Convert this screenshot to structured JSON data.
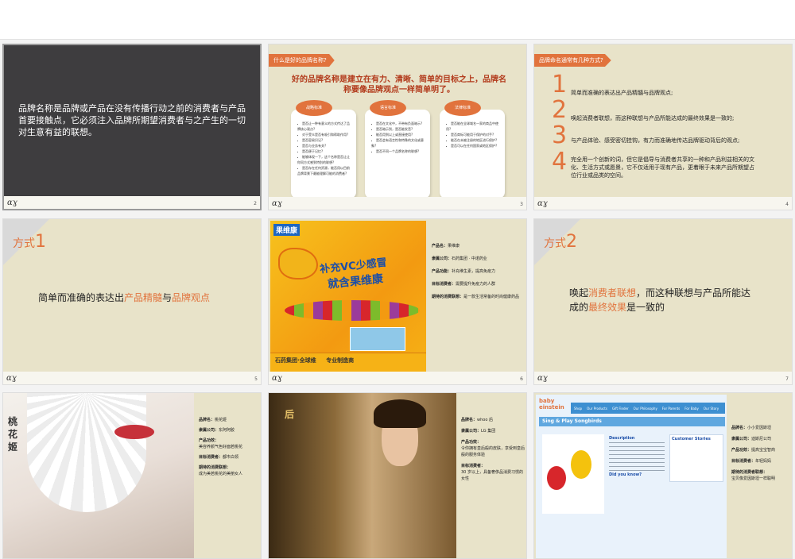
{
  "slides": [
    {
      "num": "2",
      "text": "品牌名称是品牌或产品在没有传播行动之前的消费者与产品首要接触点，它必须注入品牌所期望消费者与之产生的一切对生意有益的联想。"
    },
    {
      "num": "3",
      "tab": "什么是好的品牌名称?",
      "title": "好的品牌名称是建立在有力、清晰、简单的目标之上，品牌名称要像品牌观点一样简单明了。",
      "bubbles": [
        {
          "head": "战略标准",
          "items": [
            "是否让一种有意义的方式传达了品牌核心观点?",
            "对于受众是否有吸引和帮助作用?",
            "是否容易识记?",
            "是否与业务有关?",
            "是否便于记忆?",
            "能够体现一下，这个名称是否让让你同方式感到特别的联想?",
            "是否存在任何资源，能否用以目前品牌背景下最能理解可能的消费者?"
          ]
        },
        {
          "head": "语言标准",
          "items": [
            "是否在文化中，不带有负面暗示?",
            "是否暗示到，是否能发音?",
            "能否用到以上或直接使用?",
            "是否会有语言性和特殊的文化或意象?",
            "是否不同一个品牌名称的联想?"
          ]
        },
        {
          "head": "法律标准",
          "items": [
            "是否能在全球域名一家的商品中使用?",
            "是否商标可能用于保护的对手?",
            "能否在未被注册的地区进行保护?",
            "是否可以在任何国家或地区保护?"
          ]
        }
      ]
    },
    {
      "num": "4",
      "tab": "品牌命名通常有几种方式?",
      "items": [
        {
          "n": "1",
          "t": "简单而准确的表达出产品精髓与品牌观点;"
        },
        {
          "n": "2",
          "t": "唤起消费者联想，而这种联想与产品所能达成的最终效果是一致的;"
        },
        {
          "n": "3",
          "t": "与产品体验、感受密切挂钩，有力而准确地传达品牌驱动背后的观点;"
        },
        {
          "n": "4",
          "t": "完全用一个创新的词，但它是倡导与消费者共享的一种和产品利益相关的文化、生活方式或愿景，它不仅适用于现有产品，更着眼于未来产品所期望占位行业或品类的空间。"
        }
      ]
    },
    {
      "num": "5",
      "way_label": "方式",
      "way_num": "1",
      "s1": "简单而准确的表达出",
      "h1": "产品精髓",
      "s2": "与",
      "h2": "品牌观点"
    },
    {
      "num": "6",
      "brand_logo": "果维康",
      "slogan1": "补充VC少感冒",
      "slogan2": "就含果维康",
      "footer_brand": "石药集团·全球维",
      "footer2": "专业制造商",
      "fields": [
        {
          "k": "产品名：",
          "v": "果维康"
        },
        {
          "k": "隶属公司：",
          "v": "石药集团 · 中诺药业"
        },
        {
          "k": "产品功能：",
          "v": "补充维生素，提高免疫力"
        },
        {
          "k": "目标消费者：",
          "v": "需要提升免疫力的人群"
        },
        {
          "k": "期待的消费联想：",
          "v": "是一款生活常备的时尚健康药品"
        }
      ]
    },
    {
      "num": "7",
      "way_label": "方式",
      "way_num": "2",
      "s1": "唤起",
      "h1": "消费者联想",
      "s2": "，而这种联想与产品所能达成的",
      "h2": "最终效果",
      "s3": "是一致的"
    },
    {
      "num": "8",
      "side": "桃花姬",
      "fields": [
        {
          "k": "品牌名：",
          "v": "桃花姬"
        },
        {
          "k": "隶属公司：",
          "v": "东阿阿胶"
        },
        {
          "k": "产品功效：",
          "v": "美容养颜气色好面若桃花"
        },
        {
          "k": "目标消费者：",
          "v": "都市白领"
        },
        {
          "k": "期待的消费联想：",
          "v": "成为美若桃花的美丽女人"
        }
      ]
    },
    {
      "num": "9",
      "fields": [
        {
          "k": "品牌名：",
          "v": "whoo 后"
        },
        {
          "k": "隶属公司：",
          "v": "LG 集团"
        },
        {
          "k": "产品功效：",
          "v": "令你拥有皇后般的皮肤，享受到皇后般的服务体验"
        },
        {
          "k": "目标消费者：",
          "v": "30 岁以上，具备奢侈品消费习惯的女性"
        }
      ]
    },
    {
      "num": "10",
      "site_logo": "baby einstein",
      "site_title": "Sing & Play Songbirds",
      "site_desc": "Description",
      "site_side": "Customer Stories",
      "site_q": "Did you know?",
      "nav": [
        "Shop",
        "Our Products",
        "Gift Finder",
        "Our Philosophy",
        "For Parents",
        "For Baby",
        "Our Story"
      ],
      "fields": [
        {
          "k": "品牌名：",
          "v": "小小爱因斯坦"
        },
        {
          "k": "隶属公司：",
          "v": "迪斯尼公司"
        },
        {
          "k": "产品功效：",
          "v": "提高宝宝智商"
        },
        {
          "k": "目标消费者：",
          "v": "年轻妈妈"
        },
        {
          "k": "期待的消费者联想：",
          "v": "宝贝像爱因斯坦一样聪明"
        }
      ]
    }
  ],
  "colors": {
    "accent": "#e1733d",
    "dark": "#3e3d3f",
    "beige": "#e8e3c9"
  }
}
